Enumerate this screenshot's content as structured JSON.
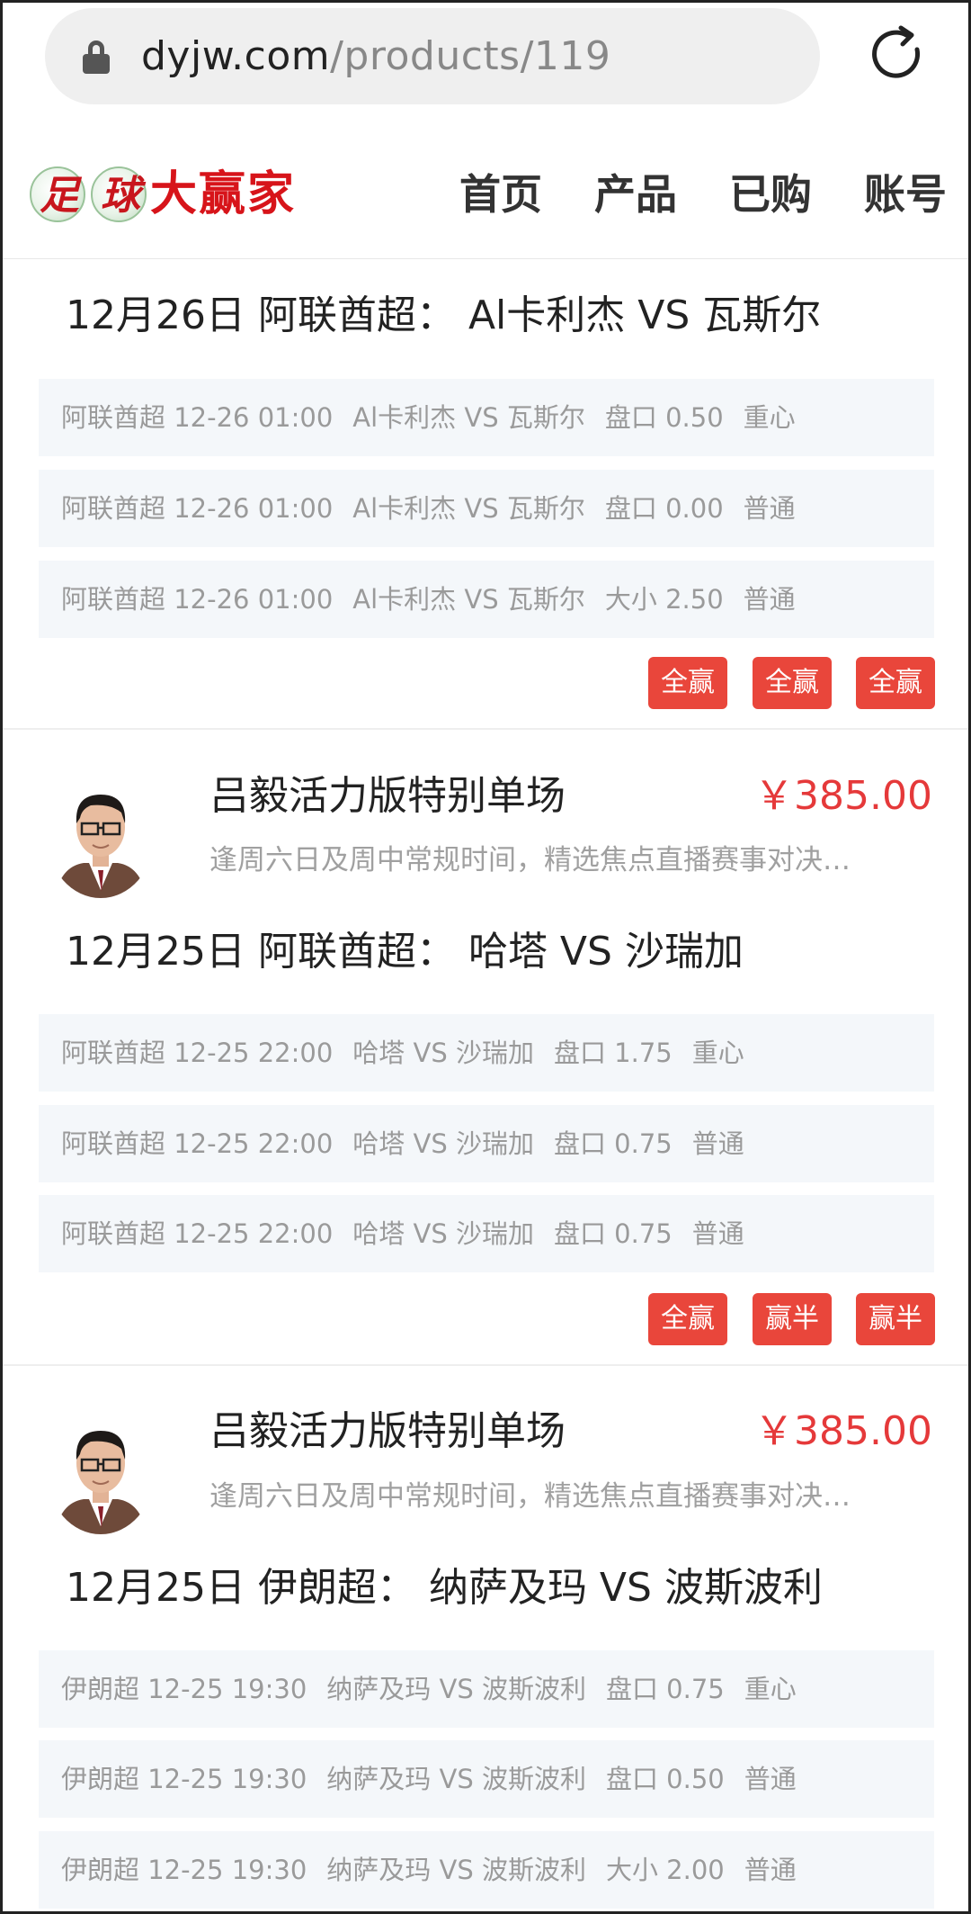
{
  "browser": {
    "url_host": "dyjw.com",
    "url_path": "/products/119"
  },
  "header": {
    "logo_ball_1": "足",
    "logo_ball_2": "球",
    "logo_text": "大赢家",
    "nav": [
      "首页",
      "产品",
      "已购",
      "账号"
    ]
  },
  "cards": [
    {
      "title": "12月26日 阿联酋超： Al卡利杰 VS 瓦斯尔",
      "tips": [
        [
          "阿联酋超 12-26 01:00",
          "Al卡利杰 VS 瓦斯尔",
          "盘口 0.50",
          "重心"
        ],
        [
          "阿联酋超 12-26 01:00",
          "Al卡利杰 VS 瓦斯尔",
          "盘口 0.00",
          "普通"
        ],
        [
          "阿联酋超 12-26 01:00",
          "Al卡利杰 VS 瓦斯尔",
          "大小 2.50",
          "普通"
        ]
      ],
      "results": [
        "全赢",
        "全赢",
        "全赢"
      ]
    },
    {
      "product_name": "吕毅活力版特别单场",
      "price": "￥385.00",
      "description": "逢周六日及周中常规时间，精选焦点直播赛事对决…",
      "title": "12月25日 阿联酋超： 哈塔 VS 沙瑞加",
      "tips": [
        [
          "阿联酋超 12-25 22:00",
          "哈塔 VS 沙瑞加",
          "盘口 1.75",
          "重心"
        ],
        [
          "阿联酋超 12-25 22:00",
          "哈塔 VS 沙瑞加",
          "盘口 0.75",
          "普通"
        ],
        [
          "阿联酋超 12-25 22:00",
          "哈塔 VS 沙瑞加",
          "盘口 0.75",
          "普通"
        ]
      ],
      "results": [
        "全赢",
        "赢半",
        "赢半"
      ]
    },
    {
      "product_name": "吕毅活力版特别单场",
      "price": "￥385.00",
      "description": "逢周六日及周中常规时间，精选焦点直播赛事对决…",
      "title": "12月25日 伊朗超： 纳萨及玛 VS 波斯波利",
      "tips": [
        [
          "伊朗超 12-25 19:30",
          "纳萨及玛 VS 波斯波利",
          "盘口 0.75",
          "重心"
        ],
        [
          "伊朗超 12-25 19:30",
          "纳萨及玛 VS 波斯波利",
          "盘口 0.50",
          "普通"
        ],
        [
          "伊朗超 12-25 19:30",
          "纳萨及玛 VS 波斯波利",
          "大小 2.00",
          "普通"
        ]
      ]
    }
  ],
  "colors": {
    "brand_red": "#d7141a",
    "badge_red": "#e9463b",
    "price_red": "#e5393a",
    "row_bg": "#f4f7fa"
  }
}
